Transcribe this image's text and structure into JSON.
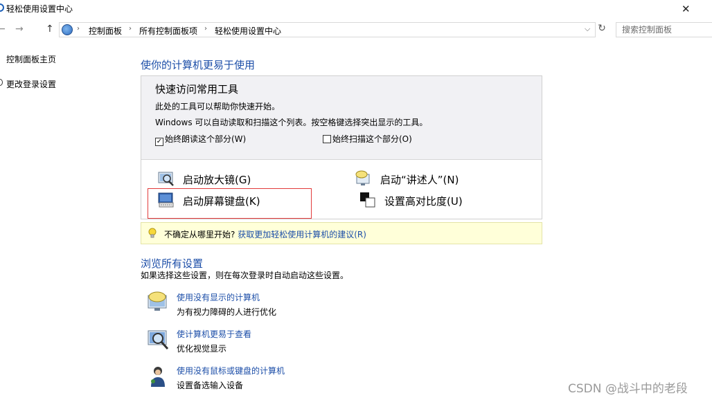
{
  "window": {
    "title": "轻松使用设置中心"
  },
  "nav": {
    "back_glyph": "←",
    "forward_glyph": "→",
    "up_glyph": "↑",
    "breadcrumb": [
      "控制面板",
      "所有控制面板项",
      "轻松使用设置中心"
    ],
    "separator": "›",
    "dropdown_glyph": "⌵",
    "refresh_glyph": "↻",
    "search_placeholder": "搜索控制面板"
  },
  "sidebar": {
    "items": [
      {
        "label": "控制面板主页"
      },
      {
        "label": "更改登录设置"
      }
    ]
  },
  "main": {
    "heading": "使你的计算机更易于使用",
    "quick": {
      "title": "快速访问常用工具",
      "line1": "此处的工具可以帮助你快速开始。",
      "line2": "Windows 可以自动读取和扫描这个列表。按空格键选择突出显示的工具。",
      "check_read": {
        "label": "始终朗读这个部分(W)",
        "checked": true,
        "mark": "✓"
      },
      "check_scan": {
        "label": "始终扫描这个部分(O)",
        "checked": false,
        "mark": ""
      },
      "tools": [
        {
          "label": "启动放大镜(G)",
          "icon": "magnifier-icon"
        },
        {
          "label": "启动“讲述人”(N)",
          "icon": "narrator-icon"
        },
        {
          "label": "启动屏幕键盘(K)",
          "icon": "on-screen-keyboard-icon"
        },
        {
          "label": "设置高对比度(U)",
          "icon": "high-contrast-icon"
        }
      ]
    },
    "tip": {
      "prefix": "不确定从哪里开始?",
      "link": "获取更加轻松使用计算机的建议(R)",
      "icon": "lightbulb-icon"
    },
    "browse": {
      "heading": "浏览所有设置",
      "subtitle": "如果选择这些设置，则在每次登录时自动启动这些设置。",
      "items": [
        {
          "link": "使用没有显示的计算机",
          "desc": "为有视力障碍的人进行优化",
          "icon": "speech-monitor-icon"
        },
        {
          "link": "使计算机更易于查看",
          "desc": "优化视觉显示",
          "icon": "magnify-monitor-icon"
        },
        {
          "link": "使用没有鼠标或键盘的计算机",
          "desc": "设置备选输入设备",
          "icon": "user-input-icon"
        }
      ]
    }
  },
  "watermark": "CSDN @战斗中的老段",
  "colors": {
    "link": "#1c4ea8",
    "tip_background": "#ffffd9",
    "quick_header": "#f1f1f4",
    "highlight": "#e23a3a"
  }
}
